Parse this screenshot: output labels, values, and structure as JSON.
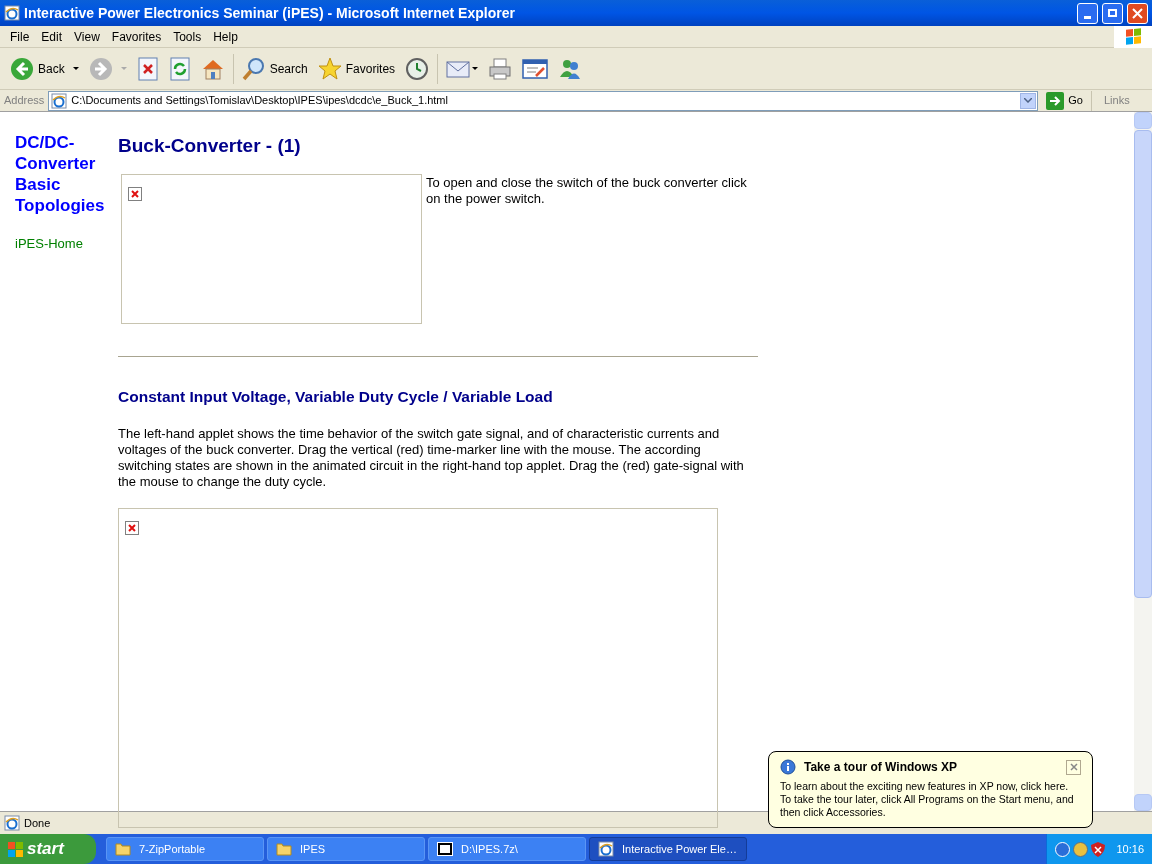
{
  "window": {
    "title": "Interactive Power Electronics Seminar (iPES) - Microsoft Internet Explorer"
  },
  "menu": [
    "File",
    "Edit",
    "View",
    "Favorites",
    "Tools",
    "Help"
  ],
  "toolbar": [
    {
      "kind": "back",
      "label": "Back"
    },
    {
      "kind": "forward"
    },
    {
      "kind": "stop"
    },
    {
      "kind": "refresh"
    },
    {
      "kind": "home"
    },
    {
      "kind": "search",
      "label": "Search"
    },
    {
      "kind": "favorites",
      "label": "Favorites"
    },
    {
      "kind": "history"
    },
    {
      "kind": "mail"
    },
    {
      "kind": "print"
    },
    {
      "kind": "edit"
    },
    {
      "kind": "messenger"
    }
  ],
  "address": {
    "label": "Address",
    "value": "C:\\Documents and Settings\\Tomislav\\Desktop\\IPES\\ipes\\dcdc\\e_Buck_1.html",
    "go": "Go",
    "links": "Links"
  },
  "sidebar": {
    "heading": "DC/DC-Converter Basic Topologies",
    "link": "iPES-Home"
  },
  "content": {
    "title": "Buck-Converter - (1)",
    "applet_text": "To open and close the switch of the buck converter click on the power switch.",
    "subheading": "Constant Input Voltage, Variable Duty Cycle / Variable Load",
    "paragraph": "The left-hand applet shows the time behavior of the switch gate signal, and of characteristic currents and voltages of the buck converter. Drag the vertical (red) time-marker line with the mouse. The according switching states are shown in the animated circuit in the right-hand top applet. Drag the (red) gate-signal with the mouse to change the duty cycle."
  },
  "status": "Done",
  "taskbar": {
    "start": "start",
    "tasks": [
      {
        "label": "7-ZipPortable",
        "kind": "folder",
        "selected": false
      },
      {
        "label": "IPES",
        "kind": "folder",
        "selected": false
      },
      {
        "label": "D:\\IPES.7z\\",
        "kind": "zip",
        "selected": false
      },
      {
        "label": "Interactive Power Ele…",
        "kind": "ie",
        "selected": true
      }
    ],
    "clock": "10:16"
  },
  "balloon": {
    "title": "Take a tour of Windows XP",
    "text": "To learn about the exciting new features in XP now, click here. To take the tour later, click All Programs on the Start menu, and then click Accessories."
  }
}
